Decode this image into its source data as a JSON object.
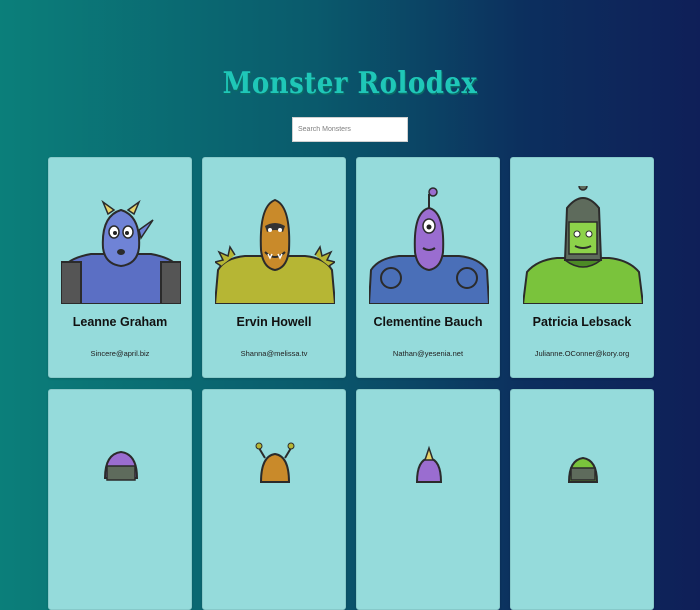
{
  "app": {
    "title": "Monster Rolodex"
  },
  "search": {
    "placeholder": "Search Monsters",
    "value": ""
  },
  "monsters": [
    {
      "name": "Leanne Graham",
      "email": "Sincere@april.biz"
    },
    {
      "name": "Ervin Howell",
      "email": "Shanna@melissa.tv"
    },
    {
      "name": "Clementine Bauch",
      "email": "Nathan@yesenia.net"
    },
    {
      "name": "Patricia Lebsack",
      "email": "Julianne.OConner@kory.org"
    },
    {
      "name": "",
      "email": ""
    },
    {
      "name": "",
      "email": ""
    },
    {
      "name": "",
      "email": ""
    },
    {
      "name": "",
      "email": ""
    }
  ],
  "colors": {
    "background_start": "#0b7f7a",
    "background_end": "#0f1f58",
    "title": "#1fc7b8",
    "card": "#95dbdb"
  }
}
